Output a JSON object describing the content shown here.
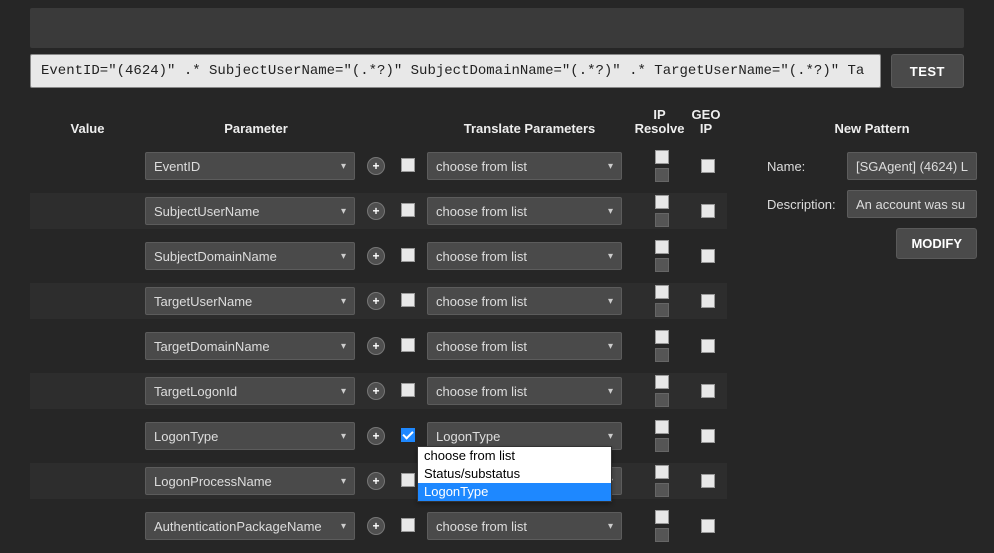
{
  "pattern_text": "EventID=\"(4624)\" .* SubjectUserName=\"(.*?)\" SubjectDomainName=\"(.*?)\" .* TargetUserName=\"(.*?)\" Ta",
  "test_label": "TEST",
  "headers": {
    "value": "Value",
    "parameter": "Parameter",
    "translate": "Translate Parameters",
    "ip_resolve_l1": "IP",
    "ip_resolve_l2": "Resolve",
    "geo_l1": "GEO",
    "geo_l2": "IP"
  },
  "translate_placeholder": "choose from list",
  "rows": [
    {
      "param": "EventID",
      "chk": false,
      "trans": "choose from list"
    },
    {
      "param": "SubjectUserName",
      "chk": false,
      "trans": "choose from list"
    },
    {
      "param": "SubjectDomainName",
      "chk": false,
      "trans": "choose from list"
    },
    {
      "param": "TargetUserName",
      "chk": false,
      "trans": "choose from list"
    },
    {
      "param": "TargetDomainName",
      "chk": false,
      "trans": "choose from list"
    },
    {
      "param": "TargetLogonId",
      "chk": false,
      "trans": "choose from list"
    },
    {
      "param": "LogonType",
      "chk": true,
      "trans": "LogonType",
      "open": true
    },
    {
      "param": "LogonProcessName",
      "chk": false,
      "trans": "choose from list"
    },
    {
      "param": "AuthenticationPackageName",
      "chk": false,
      "trans": "choose from list"
    }
  ],
  "dropdown_options": [
    {
      "label": "choose from list",
      "hl": false
    },
    {
      "label": "Status/substatus",
      "hl": false
    },
    {
      "label": "LogonType",
      "hl": true
    }
  ],
  "new_pattern": {
    "title": "New Pattern",
    "name_label": "Name:",
    "name_value": "[SGAgent] (4624) L",
    "desc_label": "Description:",
    "desc_value": "An account was su",
    "modify_label": "MODIFY"
  }
}
